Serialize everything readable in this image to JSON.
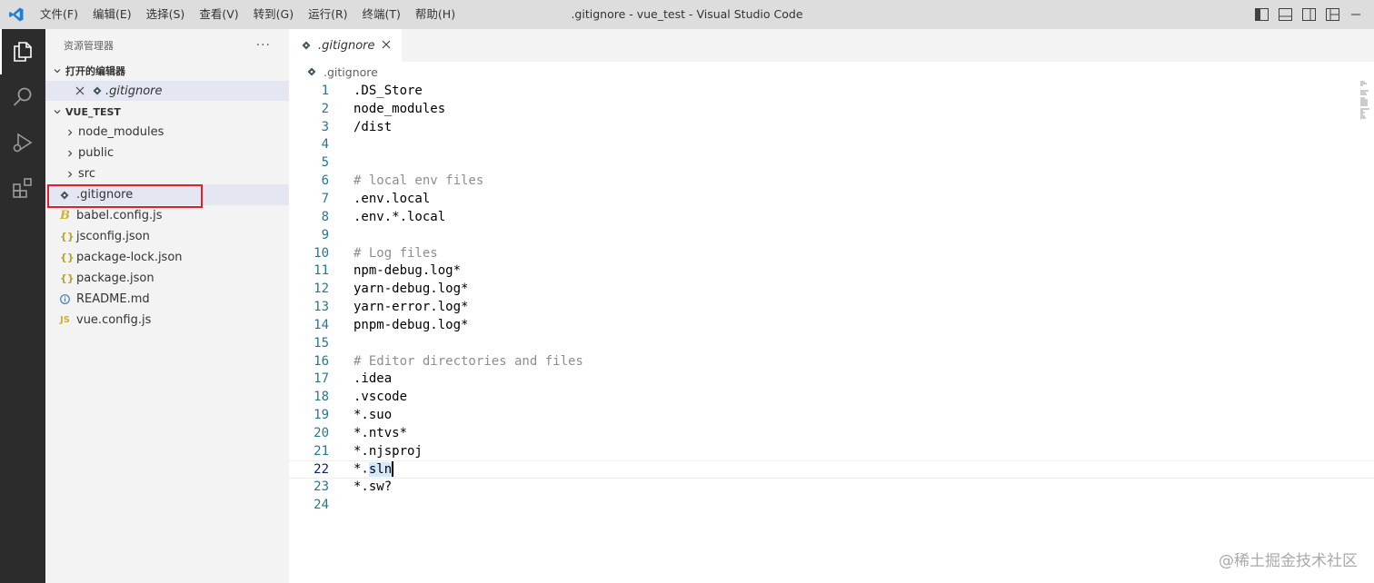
{
  "titlebar": {
    "menus": [
      "文件(F)",
      "编辑(E)",
      "选择(S)",
      "查看(V)",
      "转到(G)",
      "运行(R)",
      "终端(T)",
      "帮助(H)"
    ],
    "window_title": ".gitignore - vue_test - Visual Studio Code"
  },
  "sidebar": {
    "title": "资源管理器",
    "more": "···",
    "open_editors_label": "打开的编辑器",
    "open_editor_file": ".gitignore",
    "project_label": "VUE_TEST",
    "items": [
      {
        "label": "node_modules",
        "type": "folder"
      },
      {
        "label": "public",
        "type": "folder"
      },
      {
        "label": "src",
        "type": "folder"
      },
      {
        "label": ".gitignore",
        "type": "git"
      },
      {
        "label": "babel.config.js",
        "type": "babel"
      },
      {
        "label": "jsconfig.json",
        "type": "json"
      },
      {
        "label": "package-lock.json",
        "type": "json"
      },
      {
        "label": "package.json",
        "type": "json"
      },
      {
        "label": "README.md",
        "type": "info"
      },
      {
        "label": "vue.config.js",
        "type": "js"
      }
    ]
  },
  "editor": {
    "tab_label": ".gitignore",
    "breadcrumb": ".gitignore",
    "lines": [
      ".DS_Store",
      "node_modules",
      "/dist",
      "",
      "",
      "# local env files",
      ".env.local",
      ".env.*.local",
      "",
      "# Log files",
      "npm-debug.log*",
      "yarn-debug.log*",
      "yarn-error.log*",
      "pnpm-debug.log*",
      "",
      "# Editor directories and files",
      ".idea",
      ".vscode",
      "*.suo",
      "*.ntvs*",
      "*.njsproj",
      "*.sln",
      "*.sw?",
      ""
    ],
    "current_line": 22
  },
  "watermark": "@稀土掘金技术社区",
  "colors": {
    "activity_bar": "#2c2c2c",
    "sidebar_bg": "#f3f3f3",
    "selection": "#e4e6f1",
    "highlight_box": "#e0202c",
    "line_number": "#237893",
    "comment": "#8e8e8e"
  }
}
